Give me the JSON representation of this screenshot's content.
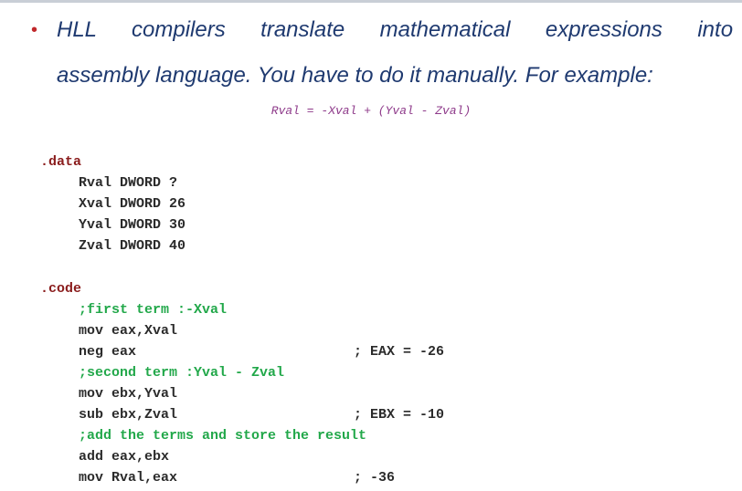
{
  "slide": {
    "bullet_words": [
      "HLL",
      "compilers",
      "translate",
      "mathematical",
      "expressions",
      "into"
    ],
    "bullet_line2": "assembly language. You have to do it manually. For example:",
    "formula": "Rval = -Xval + (Yval - Zval)"
  },
  "code": {
    "data_directive": ".data",
    "data_lines": [
      "Rval DWORD ?",
      "Xval DWORD 26",
      "Yval DWORD 30",
      "Zval DWORD 40"
    ],
    "code_directive": ".code",
    "comment_first": ";first term :-Xval",
    "mov_eax": "mov eax,Xval",
    "neg_eax": "neg eax",
    "neg_eax_comment": "; EAX = -26",
    "comment_second": ";second term :Yval - Zval",
    "mov_ebx": "mov ebx,Yval",
    "sub_ebx": "sub ebx,Zval",
    "sub_ebx_comment": "; EBX = -10",
    "comment_add": ";add the terms and store the result",
    "add_eax": "add eax,ebx",
    "mov_rval": "mov Rval,eax",
    "mov_rval_comment": "; -36"
  },
  "colors": {
    "bullet_text": "#1f3a70",
    "bullet_dot": "#c0282b",
    "formula": "#8e3a8a",
    "directive": "#8a1c1c",
    "comment": "#22a84a"
  }
}
